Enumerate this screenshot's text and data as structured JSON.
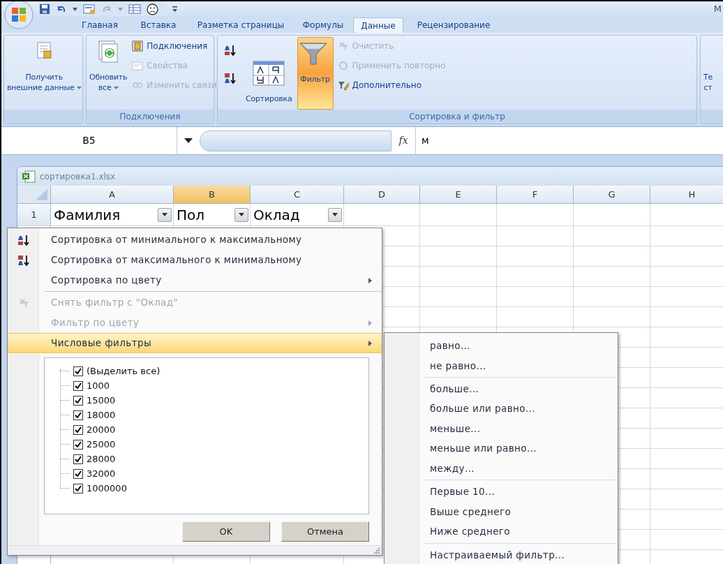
{
  "window": {
    "title": "M"
  },
  "tabs": [
    {
      "label": "Главная",
      "selected": false
    },
    {
      "label": "Вставка",
      "selected": false
    },
    {
      "label": "Разметка страницы",
      "selected": false
    },
    {
      "label": "Формулы",
      "selected": false
    },
    {
      "label": "Данные",
      "selected": true
    },
    {
      "label": "Рецензирование",
      "selected": false
    }
  ],
  "ribbon": {
    "groups": [
      {
        "columns": [
          [
            {
              "kind": "large",
              "lines": [
                "Получить",
                "внешние данные"
              ],
              "dropdown": true
            }
          ]
        ]
      },
      {
        "label": "Подключения",
        "columns": [
          [
            {
              "kind": "large",
              "lines": [
                "Обновить",
                "все"
              ],
              "dropdown": true
            }
          ],
          [
            {
              "kind": "small",
              "label": "Подключения",
              "disabled": false
            },
            {
              "kind": "small",
              "label": "Свойства",
              "disabled": true
            },
            {
              "kind": "small",
              "label": "Изменить связи",
              "disabled": true
            }
          ]
        ]
      },
      {
        "label": "Сортировка и фильтр",
        "columns": [
          [
            {
              "kind": "icon"
            },
            {
              "kind": "icon"
            }
          ],
          [
            {
              "kind": "large",
              "lines": [
                "Сортировка"
              ],
              "on": false
            }
          ],
          [
            {
              "kind": "large",
              "lines": [
                "Фильтр"
              ],
              "on": true
            }
          ],
          [
            {
              "kind": "small",
              "label": "Очистить",
              "disabled": true
            },
            {
              "kind": "small",
              "label": "Применить повторно",
              "disabled": true
            },
            {
              "kind": "small",
              "label": "Дополнительно",
              "disabled": false
            }
          ]
        ]
      },
      {
        "columns": [
          [
            {
              "kind": "large",
              "lines": [
                "Те",
                "ст"
              ]
            }
          ]
        ]
      }
    ]
  },
  "formula_bar": {
    "name_box": "B5",
    "function_button": "fx",
    "formula": "м"
  },
  "workbook": {
    "title": "сортировка1.xlsx",
    "columns": [
      {
        "label": "A",
        "selected": false
      },
      {
        "label": "B",
        "selected": true
      },
      {
        "label": "C",
        "selected": false
      },
      {
        "label": "D",
        "selected": false
      },
      {
        "label": "E",
        "selected": false
      },
      {
        "label": "F",
        "selected": false
      },
      {
        "label": "G",
        "selected": false
      },
      {
        "label": "H",
        "selected": false
      }
    ],
    "rows": [
      {
        "number": "1",
        "cells": [
          {
            "text": "Фамилия",
            "filter": true
          },
          {
            "text": "Пол",
            "filter": true
          },
          {
            "text": "Оклад",
            "filter": true
          }
        ]
      }
    ]
  },
  "filter_menu": {
    "items": [
      {
        "kind": "sort_asc",
        "label": "Сортировка от минимального к максимальному",
        "disabled": false,
        "submenu": false,
        "highlighted": false,
        "separator_before": false
      },
      {
        "kind": "sort_desc",
        "label": "Сортировка от максимального к минимальному",
        "disabled": false,
        "submenu": false,
        "highlighted": false,
        "separator_before": false
      },
      {
        "kind": "command",
        "label": "Сортировка по цвету",
        "disabled": false,
        "submenu": true,
        "highlighted": false,
        "separator_before": false
      },
      {
        "kind": "clear",
        "label": "Снять фильтр с \"Оклад\"",
        "disabled": true,
        "submenu": false,
        "highlighted": false,
        "separator_before": true
      },
      {
        "kind": "command",
        "label": "Фильтр по цвету",
        "disabled": true,
        "submenu": true,
        "highlighted": false,
        "separator_before": false
      },
      {
        "kind": "command",
        "label": "Числовые фильтры",
        "disabled": false,
        "submenu": true,
        "highlighted": true,
        "separator_before": false
      }
    ],
    "values": [
      {
        "label": "(Выделить все)",
        "checked": true
      },
      {
        "label": "1000",
        "checked": true
      },
      {
        "label": "15000",
        "checked": true
      },
      {
        "label": "18000",
        "checked": true
      },
      {
        "label": "20000",
        "checked": true
      },
      {
        "label": "25000",
        "checked": true
      },
      {
        "label": "28000",
        "checked": true
      },
      {
        "label": "32000",
        "checked": true
      },
      {
        "label": "1000000",
        "checked": true
      }
    ],
    "buttons": [
      "OK",
      "Отмена"
    ]
  },
  "submenu": {
    "items": [
      {
        "label": "равно...",
        "separator_before": false
      },
      {
        "label": "не равно...",
        "separator_before": false
      },
      {
        "label": "больше...",
        "separator_before": true
      },
      {
        "label": "больше или равно...",
        "separator_before": false
      },
      {
        "label": "меньше...",
        "separator_before": false
      },
      {
        "label": "меньше или равно...",
        "separator_before": false
      },
      {
        "label": "между...",
        "separator_before": false
      },
      {
        "label": "Первые 10...",
        "separator_before": true
      },
      {
        "label": "Выше среднего",
        "separator_before": false
      },
      {
        "label": "Ниже среднего",
        "separator_before": false
      },
      {
        "label": "Настраиваемый фильтр...",
        "separator_before": true
      }
    ]
  }
}
